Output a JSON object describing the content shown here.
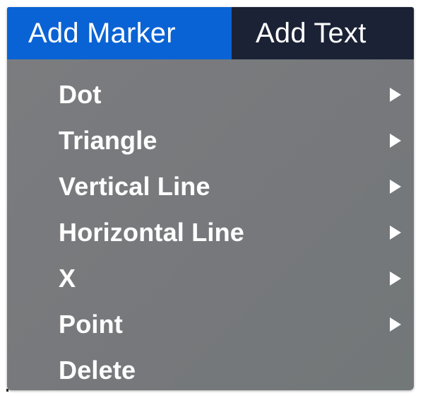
{
  "menubar": {
    "items": [
      {
        "label": "Add Marker",
        "active": true
      },
      {
        "label": "Add Text",
        "active": false
      }
    ]
  },
  "menu": {
    "items": [
      {
        "label": "Dot",
        "has_submenu": true,
        "submenu_icon": "triangle-right-icon"
      },
      {
        "label": "Triangle",
        "has_submenu": true,
        "submenu_icon": "triangle-right-icon"
      },
      {
        "label": "Vertical Line",
        "has_submenu": true,
        "submenu_icon": "triangle-right-icon"
      },
      {
        "label": "Horizontal Line",
        "has_submenu": true,
        "submenu_icon": "triangle-right-icon"
      },
      {
        "label": "X",
        "has_submenu": true,
        "submenu_icon": "triangle-right-icon"
      },
      {
        "label": "Point",
        "has_submenu": true,
        "submenu_icon": "triangle-right-icon"
      },
      {
        "label": "Delete",
        "has_submenu": false
      }
    ]
  },
  "colors": {
    "menubar_bg": "#1b2235",
    "active_bg": "#0a63d4",
    "menu_bg": "#78797c",
    "text": "#ffffff"
  }
}
